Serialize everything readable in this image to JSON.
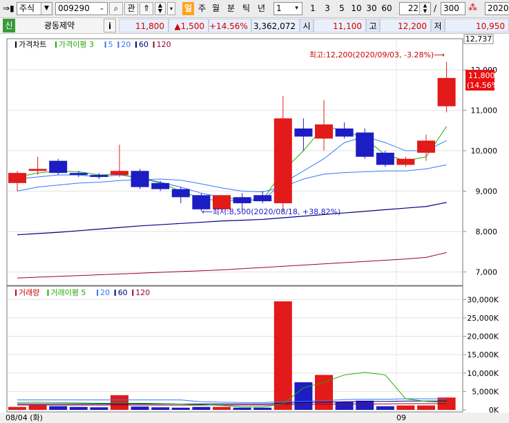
{
  "toolbar": {
    "market": "주식",
    "code": "009290",
    "btn_gwan": "관",
    "periods": [
      "일",
      "주",
      "월",
      "분",
      "틱",
      "년"
    ],
    "selected_period": "일",
    "interval_value": "1",
    "quick_intervals": [
      "1",
      "3",
      "5",
      "10",
      "30",
      "60"
    ],
    "count_value": "22",
    "slash": "/",
    "total_value": "300",
    "date_value": "2020/"
  },
  "quote": {
    "badge": "신",
    "name": "광동제약",
    "info_btn": "i",
    "price": "11,800",
    "change": "▲1,500",
    "change_pct": "+14.56%",
    "volume": "3,362,072",
    "open_label": "시",
    "open": "11,100",
    "high_label": "고",
    "high": "12,200",
    "low_label": "저",
    "low": "10,950"
  },
  "price_panel": {
    "legend": [
      {
        "text": "가격차트",
        "color": "#000000"
      },
      {
        "text": "가격이평 3",
        "color": "#22aa00"
      },
      {
        "text": "5",
        "color": "#3377ff"
      },
      {
        "text": "20",
        "color": "#3377ff"
      },
      {
        "text": "60",
        "color": "#000080"
      },
      {
        "text": "120",
        "color": "#990033"
      }
    ],
    "axis_top_label": "12,737",
    "ticks": [
      "12,000",
      "11,000",
      "10,000",
      "9,000",
      "8,000",
      "7,000"
    ],
    "tick_values": [
      12000,
      11000,
      10000,
      9000,
      8000,
      7000
    ],
    "current_price_tag": [
      "11,800",
      "(14.56%)"
    ],
    "high_annotation": "최고:12,200(2020/09/03, -3.28%)⟶",
    "low_annotation": "⟵최저:8,500(2020/08/18, +38.82%)"
  },
  "volume_panel": {
    "legend": [
      {
        "text": "거래량",
        "color": "#cc0000"
      },
      {
        "text": "거래이평 5",
        "color": "#22aa00"
      },
      {
        "text": "20",
        "color": "#3377ff"
      },
      {
        "text": "60",
        "color": "#000080"
      },
      {
        "text": "120",
        "color": "#990033"
      }
    ],
    "ticks": [
      "30,000K",
      "25,000K",
      "20,000K",
      "15,000K",
      "10,000K",
      "5,000K",
      "0K"
    ],
    "tick_values": [
      30000,
      25000,
      20000,
      15000,
      10000,
      5000,
      0
    ]
  },
  "x_axis": {
    "start_label": "08/04 (화)",
    "month_label": "09"
  },
  "colors": {
    "up": "#e31a1a",
    "down": "#1d1dc4",
    "ma3": "#22aa00",
    "ma5": "#3377ff",
    "ma20": "#3377ff",
    "ma60": "#000080",
    "ma120": "#990033",
    "vol_ma5": "#22aa00"
  },
  "chart_data": {
    "type": "candlestick",
    "candles": [
      {
        "o": 9200,
        "h": 9500,
        "l": 9000,
        "c": 9450
      },
      {
        "o": 9500,
        "h": 9850,
        "l": 9400,
        "c": 9550
      },
      {
        "o": 9750,
        "h": 9800,
        "l": 9400,
        "c": 9450
      },
      {
        "o": 9450,
        "h": 9500,
        "l": 9350,
        "c": 9400
      },
      {
        "o": 9400,
        "h": 9450,
        "l": 9300,
        "c": 9350
      },
      {
        "o": 9400,
        "h": 10150,
        "l": 9350,
        "c": 9500
      },
      {
        "o": 9500,
        "h": 9550,
        "l": 9050,
        "c": 9100
      },
      {
        "o": 9200,
        "h": 9250,
        "l": 9000,
        "c": 9050
      },
      {
        "o": 9050,
        "h": 9100,
        "l": 8700,
        "c": 8850
      },
      {
        "o": 8900,
        "h": 8950,
        "l": 8500,
        "c": 8550
      },
      {
        "o": 8550,
        "h": 8900,
        "l": 8500,
        "c": 8900
      },
      {
        "o": 8850,
        "h": 8950,
        "l": 8500,
        "c": 8700
      },
      {
        "o": 8900,
        "h": 9000,
        "l": 8700,
        "c": 8750
      },
      {
        "o": 8700,
        "h": 11350,
        "l": 8500,
        "c": 10800
      },
      {
        "o": 10550,
        "h": 10800,
        "l": 10000,
        "c": 10350
      },
      {
        "o": 10300,
        "h": 11250,
        "l": 10000,
        "c": 10650
      },
      {
        "o": 10550,
        "h": 10700,
        "l": 10300,
        "c": 10350
      },
      {
        "o": 10450,
        "h": 10550,
        "l": 9800,
        "c": 9850
      },
      {
        "o": 9950,
        "h": 10000,
        "l": 9600,
        "c": 9650
      },
      {
        "o": 9650,
        "h": 9850,
        "l": 9600,
        "c": 9800
      },
      {
        "o": 9950,
        "h": 10400,
        "l": 9750,
        "c": 10250
      },
      {
        "o": 11100,
        "h": 12200,
        "l": 10950,
        "c": 11800
      }
    ],
    "volume_k": [
      800,
      1400,
      1000,
      800,
      700,
      4000,
      900,
      700,
      600,
      800,
      800,
      600,
      600,
      29500,
      7500,
      9500,
      2200,
      2500,
      1000,
      1200,
      1200,
      3362
    ],
    "vol_ma5_k": [
      2000,
      2100,
      2000,
      1900,
      1800,
      1800,
      1800,
      1700,
      1600,
      1400,
      1200,
      800,
      800,
      1600,
      6000,
      7500,
      9500,
      10200,
      9500,
      3000,
      2300,
      2100
    ],
    "vol_ma20_k": [
      2700,
      2700,
      2700,
      2700,
      2700,
      2700,
      2700,
      2700,
      2700,
      2200,
      2100,
      2000,
      2000,
      2200,
      2300,
      2500,
      2800,
      2900,
      2900,
      3000,
      3000,
      3000
    ],
    "vol_ma60_k": [
      1600,
      1600,
      1600,
      1600,
      1600,
      1600,
      1600,
      1600,
      1600,
      1600,
      1600,
      1600,
      1600,
      1800,
      2000,
      2100,
      2200,
      2300,
      2300,
      2400,
      2400,
      2400
    ],
    "vol_ma120_k": [
      1300,
      1300,
      1300,
      1300,
      1300,
      1300,
      1300,
      1300,
      1300,
      1300,
      1300,
      1300,
      1300,
      1400,
      1500,
      1500,
      1600,
      1600,
      1600,
      1700,
      1700,
      1700
    ],
    "ma3": [
      9350,
      9450,
      9500,
      9480,
      9400,
      9420,
      9320,
      9200,
      9000,
      8820,
      8750,
      8780,
      8780,
      9500,
      10000,
      10600,
      10500,
      10300,
      9900,
      9750,
      9850,
      10600
    ],
    "ma5": [
      9300,
      9350,
      9400,
      9400,
      9350,
      9400,
      9330,
      9220,
      9100,
      8950,
      8850,
      8780,
      8780,
      9200,
      9500,
      9800,
      10200,
      10350,
      10200,
      10000,
      10000,
      10250
    ],
    "ma20": [
      9000,
      9100,
      9150,
      9200,
      9220,
      9260,
      9280,
      9300,
      9270,
      9180,
      9080,
      9000,
      8980,
      9100,
      9300,
      9420,
      9460,
      9480,
      9500,
      9500,
      9550,
      9650
    ],
    "ma60": [
      7920,
      7950,
      7980,
      8020,
      8060,
      8100,
      8140,
      8170,
      8200,
      8230,
      8260,
      8280,
      8300,
      8340,
      8380,
      8420,
      8460,
      8500,
      8540,
      8580,
      8620,
      8720
    ],
    "ma120": [
      6850,
      6870,
      6890,
      6910,
      6930,
      6950,
      6970,
      6990,
      7010,
      7030,
      7050,
      7080,
      7110,
      7140,
      7170,
      7200,
      7230,
      7260,
      7290,
      7320,
      7360,
      7480
    ],
    "ylim": [
      6700,
      12737
    ],
    "vol_ylim_k": [
      0,
      31000
    ]
  }
}
